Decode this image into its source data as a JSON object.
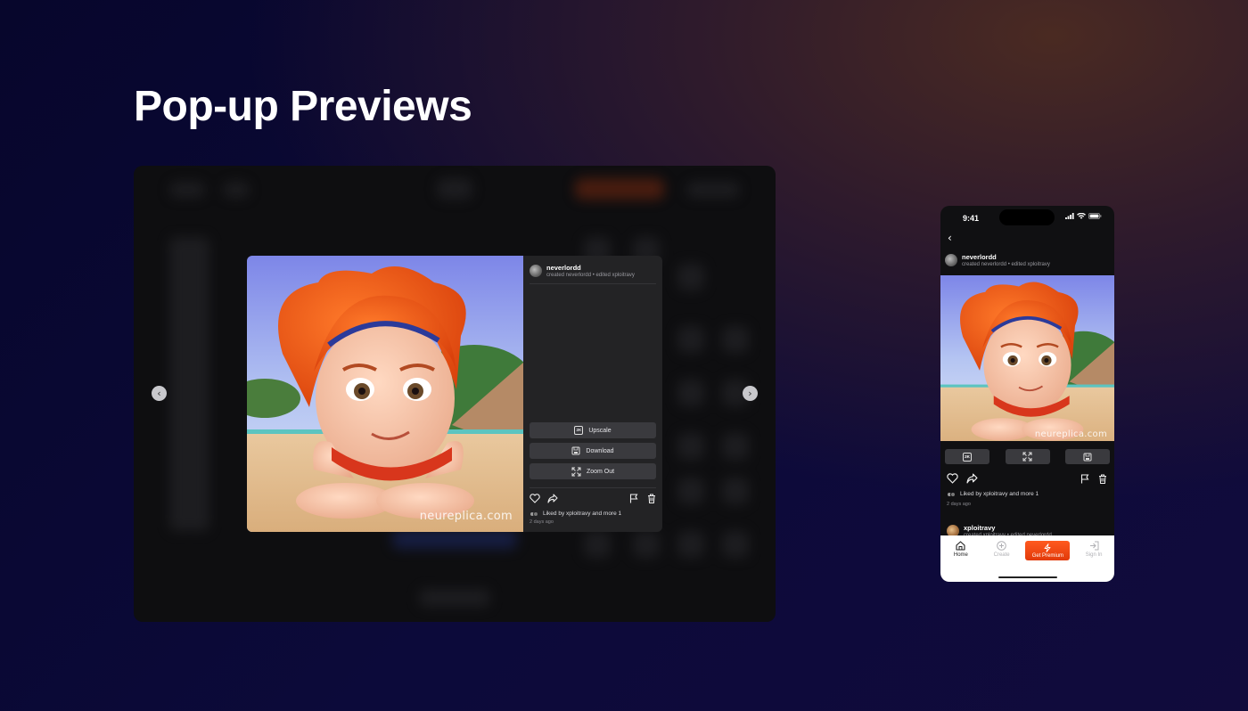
{
  "headline": "Pop-up Previews",
  "post": {
    "author": "neverlordd",
    "meta": "created neverlordd • edited xploitravy",
    "liked_by": "Liked by xploitravy and more 1",
    "time": "2 days ago",
    "watermark": "neureplica.com"
  },
  "modal": {
    "actions": [
      {
        "label": "Upscale",
        "icon": "2K"
      },
      {
        "label": "Download",
        "icon": "save-icon"
      },
      {
        "label": "Zoom Out",
        "icon": "expand-icon"
      }
    ]
  },
  "phone": {
    "status_time": "9:41",
    "upscale_icon": "2K",
    "second_author": "xploitravy",
    "second_meta": "created xploitravy • edited neverlordd",
    "tabs": {
      "home": "Home",
      "create": "Create",
      "premium": "Get Premium",
      "signin": "Sign In"
    }
  },
  "colors": {
    "premium": "#ff4d12",
    "panel": "#232325",
    "button": "#3a3a3e"
  }
}
